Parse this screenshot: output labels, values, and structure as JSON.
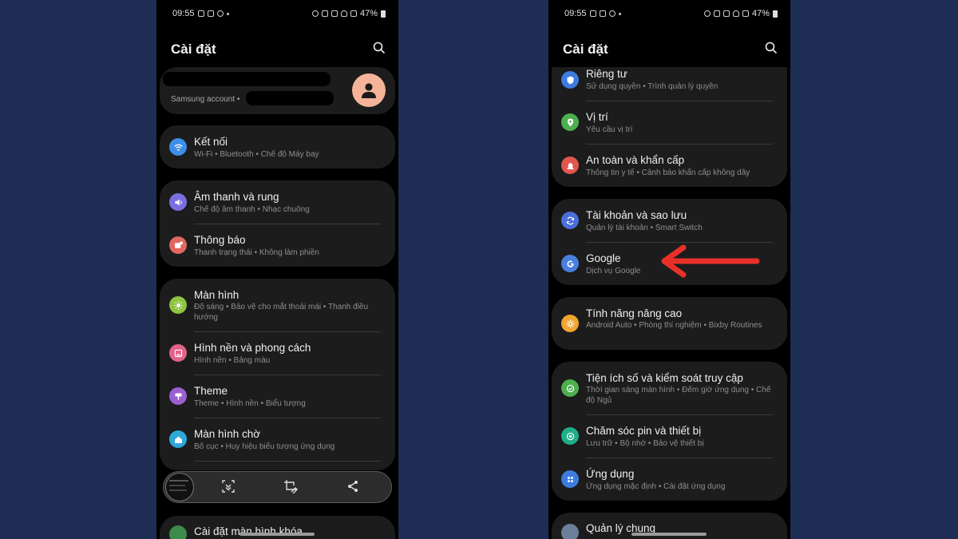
{
  "status_bar": {
    "time": "09:55",
    "battery": "47%"
  },
  "left_screen": {
    "title": "Cài đặt",
    "account": {
      "label": "Samsung account •"
    },
    "items": [
      {
        "title": "Kết nối",
        "subtitle": "Wi-Fi  •  Bluetooth  •  Chế độ Máy bay",
        "icon": "wifi-icon",
        "color": "#3d8ee8"
      },
      {
        "title": "Âm thanh và rung",
        "subtitle": "Chế độ âm thanh  •  Nhạc chuông",
        "icon": "sound-icon",
        "color": "#7a6fe0"
      },
      {
        "title": "Thông báo",
        "subtitle": "Thanh trạng thái  •  Không làm phiền",
        "icon": "notification-icon",
        "color": "#e0685e"
      },
      {
        "title": "Màn hình",
        "subtitle": "Độ sáng  •  Bảo vệ cho mắt thoải mái  •  Thanh điều hướng",
        "icon": "brightness-icon",
        "color": "#8cc43f"
      },
      {
        "title": "Hình nền và phong cách",
        "subtitle": "Hình nền  •  Bảng màu",
        "icon": "wallpaper-icon",
        "color": "#e2638a"
      },
      {
        "title": "Theme",
        "subtitle": "Theme  •  Hình nền  •  Biểu tượng",
        "icon": "theme-icon",
        "color": "#9a5fd0"
      },
      {
        "title": "Màn hình chờ",
        "subtitle": "Bố cục  •  Huy hiệu biểu tượng ứng dụng",
        "icon": "home-icon",
        "color": "#2fa7d8"
      },
      {
        "title": "Cài đặt màn hình khóa",
        "subtitle": "",
        "icon": "lock-icon",
        "color": "#3e8a4a"
      }
    ]
  },
  "right_screen": {
    "title": "Cài đặt",
    "items": [
      {
        "title": "Riêng tư",
        "subtitle": "Sử dụng quyền  •  Trình quản lý quyền",
        "icon": "privacy-icon",
        "color": "#3d7be0"
      },
      {
        "title": "Vị trí",
        "subtitle": "Yêu cầu vị trí",
        "icon": "location-icon",
        "color": "#4caf50"
      },
      {
        "title": "An toàn và khẩn cấp",
        "subtitle": "Thông tin y tế  •  Cảnh báo khẩn cấp không dây",
        "icon": "emergency-icon",
        "color": "#e0574e"
      },
      {
        "title": "Tài khoản và sao lưu",
        "subtitle": "Quản lý tài khoản  •  Smart Switch",
        "icon": "sync-icon",
        "color": "#4a6fd8"
      },
      {
        "title": "Google",
        "subtitle": "Dịch vụ Google",
        "icon": "google-icon",
        "color": "#4a7fe0"
      },
      {
        "title": "Tính năng nâng cao",
        "subtitle": "Android Auto  •  Phòng thí nghiệm  •  Bixby Routines",
        "icon": "advanced-icon",
        "color": "#f0a630"
      },
      {
        "title": "Tiện ích số và kiểm soát truy cập",
        "subtitle": "Thời gian sáng màn hình  •  Đếm giờ ứng dụng  •  Chế độ Ngủ",
        "icon": "wellbeing-icon",
        "color": "#4caf50"
      },
      {
        "title": "Chăm sóc pin và thiết bị",
        "subtitle": "Lưu trữ  •  Bộ nhớ  •  Bảo vệ thiết bị",
        "icon": "device-care-icon",
        "color": "#1fae8a"
      },
      {
        "title": "Ứng dụng",
        "subtitle": "Ứng dụng mặc định  •  Cài đặt ứng dụng",
        "icon": "apps-icon",
        "color": "#3d7be0"
      },
      {
        "title": "Quản lý chung",
        "subtitle": "",
        "icon": "general-icon",
        "color": "#6a7f98"
      }
    ]
  },
  "annotation": {
    "arrow_color": "#e8302a"
  }
}
